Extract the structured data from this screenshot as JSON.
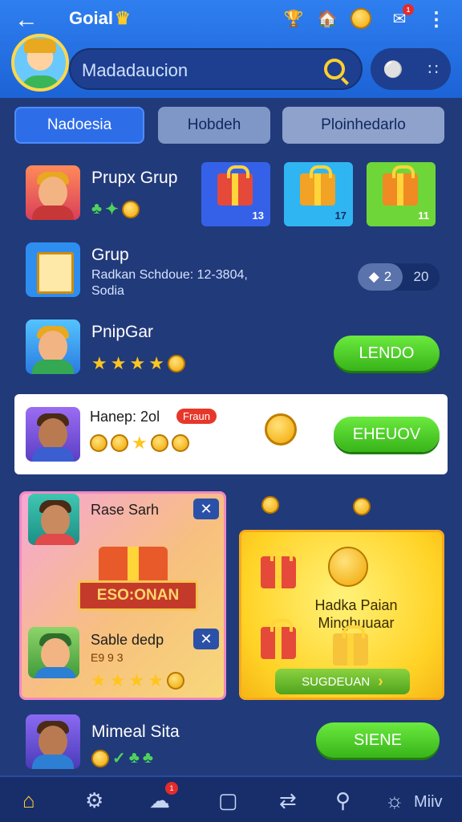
{
  "header": {
    "title": "Goial",
    "notification_badge": "1"
  },
  "search": {
    "value": "Madadaucion"
  },
  "tabs": [
    {
      "label": "Nadoesia",
      "active": true
    },
    {
      "label": "Hobdeh",
      "active": false
    },
    {
      "label": "Ploinhedarlo",
      "active": false
    }
  ],
  "row1": {
    "title": "Prupx Grup",
    "gift_counts": [
      "13",
      "17",
      "11"
    ]
  },
  "row2": {
    "title": "Grup",
    "subtitle_line1": "Radkan Schdoue: 12-3804,",
    "subtitle_line2": "Sodia",
    "toggle_on_value": "2",
    "toggle_off_value": "20"
  },
  "row3": {
    "title": "PnipGar",
    "button_label": "LENDO"
  },
  "highlight_card": {
    "title": "Hanep: 2ol",
    "tag": "Fraun",
    "button_label": "EHEUOV"
  },
  "promo_left": {
    "name_top": "Rase Sarh",
    "ribbon_text": "ESO:ONAN",
    "name_bottom": "Sable dedp",
    "sub_bottom": "E9 9 3"
  },
  "promo_right": {
    "title": "Hadka Paian Minghuuaar",
    "button_label": "SUGDEUAN"
  },
  "row4": {
    "title": "Mimeal Sita",
    "button_label": "SIENE"
  },
  "bottom_nav": {
    "badge": "1",
    "last_label": "Miiv"
  }
}
